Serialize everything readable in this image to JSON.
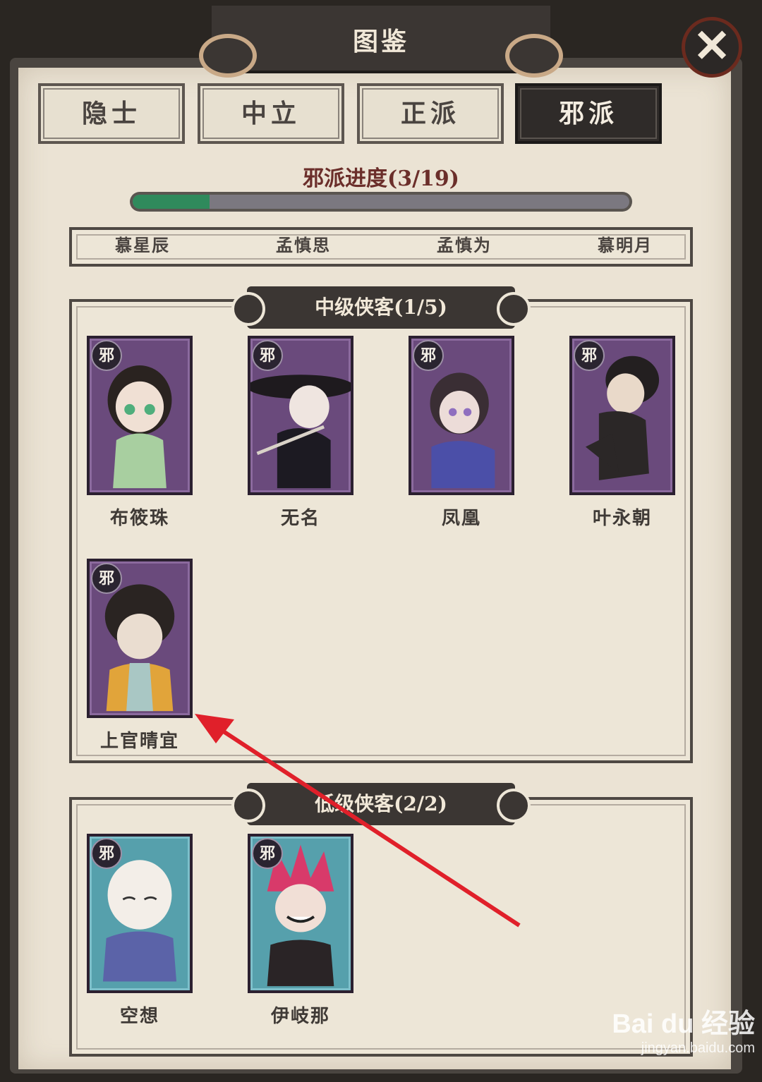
{
  "header": {
    "title": "图鉴"
  },
  "close_glyph": "✕",
  "tabs": [
    {
      "label": "隐士",
      "active": false
    },
    {
      "label": "中立",
      "active": false
    },
    {
      "label": "正派",
      "active": false
    },
    {
      "label": "邪派",
      "active": true
    }
  ],
  "progress": {
    "label": "邪派进度(3/19)",
    "value": 0.155
  },
  "top_strip": {
    "names": [
      "慕星辰",
      "孟慎思",
      "孟慎为",
      "慕明月"
    ]
  },
  "mid_section": {
    "title": "中级侠客(1/5)",
    "characters": [
      {
        "name": "布筱珠",
        "badge": "邪"
      },
      {
        "name": "无名",
        "badge": "邪"
      },
      {
        "name": "凤凰",
        "badge": "邪"
      },
      {
        "name": "叶永朝",
        "badge": "邪"
      },
      {
        "name": "上官晴宜",
        "badge": "邪"
      }
    ]
  },
  "low_section": {
    "title": "低级侠客(2/2)",
    "characters": [
      {
        "name": "空想",
        "badge": "邪"
      },
      {
        "name": "伊岐那",
        "badge": "邪"
      }
    ]
  },
  "watermark": {
    "logo": "Bai du 经验",
    "url": "jingyan.baidu.com"
  },
  "colors": {
    "progress_fill": "#2f8a5c",
    "annotation_arrow": "#e0202a",
    "card_mid": "#6a4a7c",
    "card_low": "#56a0ac"
  }
}
